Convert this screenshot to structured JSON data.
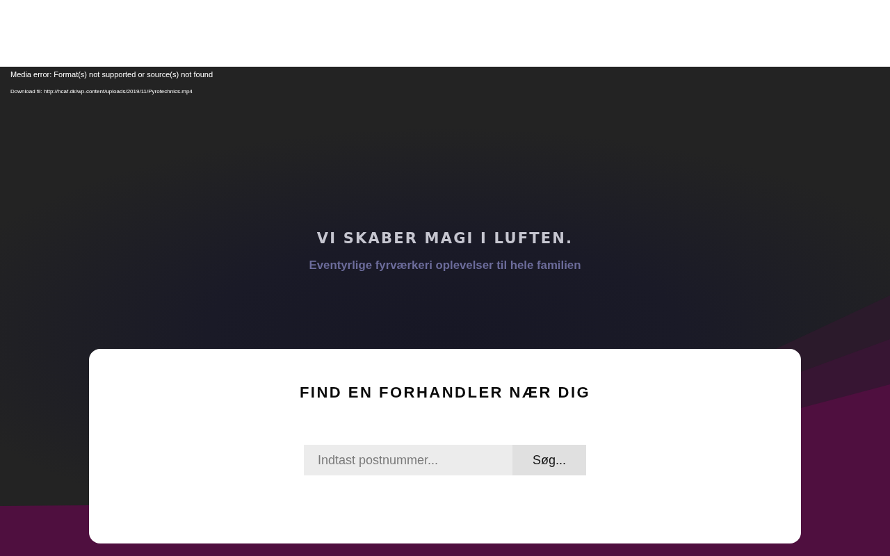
{
  "media_error": {
    "message": "Media error: Format(s) not supported or source(s) not found",
    "download_link": "Download fil: http://hcaf.dk/wp-content/uploads/2019/11/Pyrotechnics.mp4"
  },
  "hero": {
    "title": "VI SKABER MAGI I LUFTEN.",
    "subtitle": "Eventyrlige fyrværkeri oplevelser til hele familien"
  },
  "dealer_search": {
    "title": "FIND EN FORHANDLER NÆR DIG",
    "search": {
      "placeholder": "Indtast postnummer..."
    },
    "button": "Søg..."
  }
}
